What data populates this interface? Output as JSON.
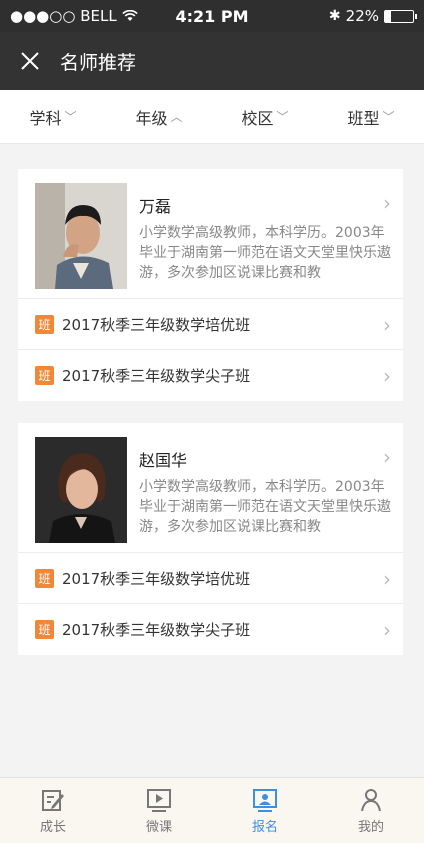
{
  "status_bar": {
    "carrier": "●●●○○ BELL",
    "time": "4:21 PM",
    "battery": "22%",
    "battery_level": 0.22
  },
  "nav": {
    "close_icon": "close-icon",
    "title": "名师推荐"
  },
  "filters": [
    {
      "label": "学科",
      "arrow": "﹀"
    },
    {
      "label": "年级",
      "arrow": "︿"
    },
    {
      "label": "校区",
      "arrow": "﹀"
    },
    {
      "label": "班型",
      "arrow": "﹀"
    }
  ],
  "teachers": [
    {
      "name": "万磊",
      "description": "小学数学高级教师，本科学历。2003年毕业于湖南第一师范在语文天堂里快乐遨游，多次参加区说课比赛和教",
      "classes": [
        {
          "badge": "班",
          "title": "2017秋季三年级数学培优班"
        },
        {
          "badge": "班",
          "title": "2017秋季三年级数学尖子班"
        }
      ]
    },
    {
      "name": "赵国华",
      "description": "小学数学高级教师，本科学历。2003年毕业于湖南第一师范在语文天堂里快乐遨游，多次参加区说课比赛和教",
      "classes": [
        {
          "badge": "班",
          "title": "2017秋季三年级数学培优班"
        },
        {
          "badge": "班",
          "title": "2017秋季三年级数学尖子班"
        }
      ]
    }
  ],
  "tabs": [
    {
      "label": "成长",
      "icon": "edit-icon"
    },
    {
      "label": "微课",
      "icon": "play-icon"
    },
    {
      "label": "报名",
      "icon": "signup-icon",
      "active": true
    },
    {
      "label": "我的",
      "icon": "user-icon"
    }
  ],
  "colors": {
    "accent": "#3d8fe0",
    "badge": "#f0883a",
    "header": "#333333"
  }
}
